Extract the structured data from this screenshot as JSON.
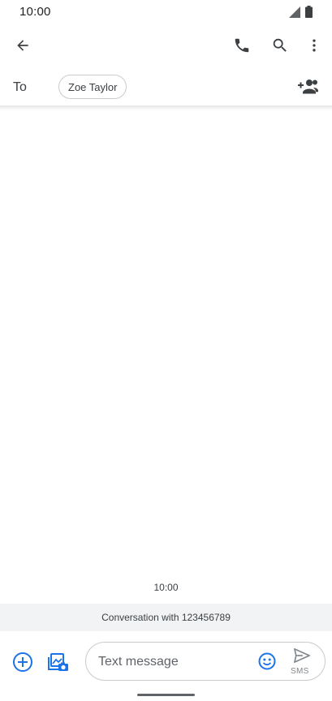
{
  "status_bar": {
    "time": "10:00",
    "icons": [
      "signal-icon",
      "battery-icon"
    ]
  },
  "toolbar": {
    "icons": [
      "back-arrow-icon",
      "phone-icon",
      "search-icon",
      "more-vert-icon"
    ]
  },
  "recipient": {
    "to_label": "To",
    "chip_name": "Zoe Taylor",
    "add_icon": "add-person-icon"
  },
  "conversation": {
    "timestamp": "10:00",
    "info": "Conversation with 123456789"
  },
  "compose": {
    "placeholder": "Text message",
    "send_type": "SMS",
    "icons": [
      "add-circle-icon",
      "gallery-icon",
      "emoji-icon",
      "send-icon"
    ]
  },
  "colors": {
    "accent": "#1a73e8",
    "icon": "#3c4043",
    "bar_bg": "#f1f3f4"
  }
}
